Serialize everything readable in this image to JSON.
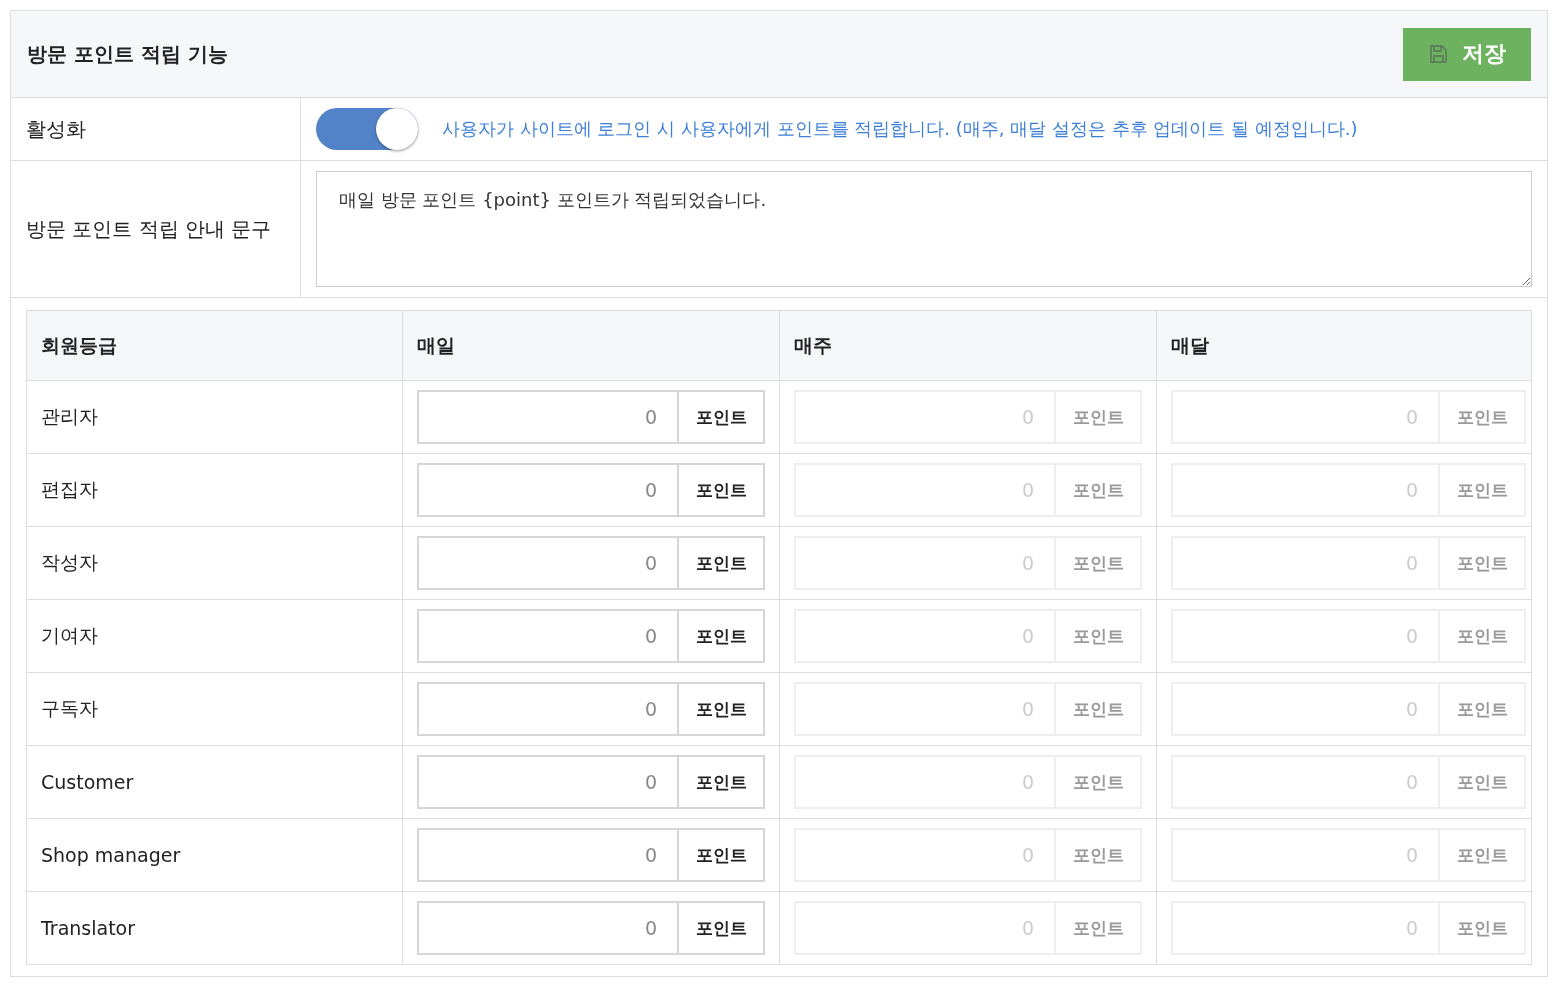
{
  "panel": {
    "title": "방문 포인트 적립 기능",
    "save_button": "저장"
  },
  "settings": {
    "activation": {
      "label": "활성화",
      "on": true,
      "description": "사용자가 사이트에 로그인 시 사용자에게 포인트를 적립합니다. (매주, 매달 설정은 추후 업데이트 될 예정입니다.)"
    },
    "message": {
      "label": "방문 포인트 적립 안내 문구",
      "value": "매일 방문 포인트 {point} 포인트가 적립되었습니다."
    }
  },
  "table": {
    "columns": [
      "회원등급",
      "매일",
      "매주",
      "매달"
    ],
    "rows": [
      {
        "grade": "관리자",
        "cells": [
          {
            "value": "0",
            "unit": "포인트",
            "disabled": false
          },
          {
            "value": "0",
            "unit": "포인트",
            "disabled": true
          },
          {
            "value": "0",
            "unit": "포인트",
            "disabled": true
          }
        ]
      },
      {
        "grade": "편집자",
        "cells": [
          {
            "value": "0",
            "unit": "포인트",
            "disabled": false
          },
          {
            "value": "0",
            "unit": "포인트",
            "disabled": true
          },
          {
            "value": "0",
            "unit": "포인트",
            "disabled": true
          }
        ]
      },
      {
        "grade": "작성자",
        "cells": [
          {
            "value": "0",
            "unit": "포인트",
            "disabled": false
          },
          {
            "value": "0",
            "unit": "포인트",
            "disabled": true
          },
          {
            "value": "0",
            "unit": "포인트",
            "disabled": true
          }
        ]
      },
      {
        "grade": "기여자",
        "cells": [
          {
            "value": "0",
            "unit": "포인트",
            "disabled": false
          },
          {
            "value": "0",
            "unit": "포인트",
            "disabled": true
          },
          {
            "value": "0",
            "unit": "포인트",
            "disabled": true
          }
        ]
      },
      {
        "grade": "구독자",
        "cells": [
          {
            "value": "0",
            "unit": "포인트",
            "disabled": false
          },
          {
            "value": "0",
            "unit": "포인트",
            "disabled": true
          },
          {
            "value": "0",
            "unit": "포인트",
            "disabled": true
          }
        ]
      },
      {
        "grade": "Customer",
        "cells": [
          {
            "value": "0",
            "unit": "포인트",
            "disabled": false
          },
          {
            "value": "0",
            "unit": "포인트",
            "disabled": true
          },
          {
            "value": "0",
            "unit": "포인트",
            "disabled": true
          }
        ]
      },
      {
        "grade": "Shop manager",
        "cells": [
          {
            "value": "0",
            "unit": "포인트",
            "disabled": false
          },
          {
            "value": "0",
            "unit": "포인트",
            "disabled": true
          },
          {
            "value": "0",
            "unit": "포인트",
            "disabled": true
          }
        ]
      },
      {
        "grade": "Translator",
        "cells": [
          {
            "value": "0",
            "unit": "포인트",
            "disabled": false
          },
          {
            "value": "0",
            "unit": "포인트",
            "disabled": true
          },
          {
            "value": "0",
            "unit": "포인트",
            "disabled": true
          }
        ]
      }
    ]
  }
}
